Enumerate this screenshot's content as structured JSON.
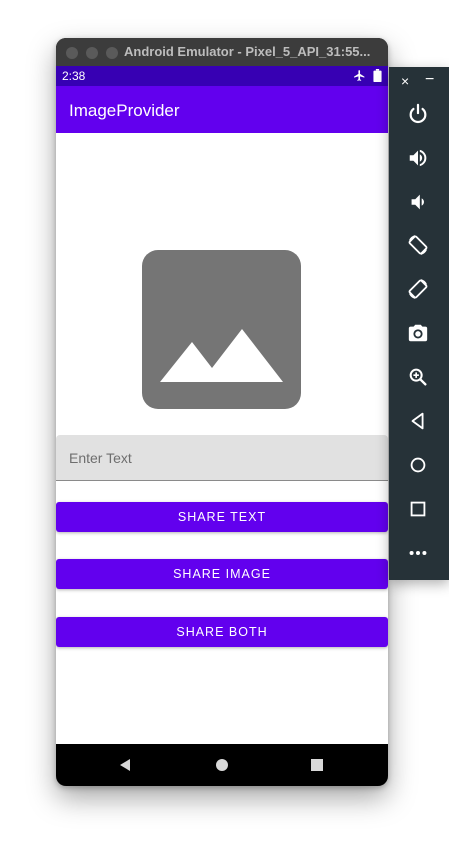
{
  "window": {
    "title": "Android Emulator - Pixel_5_API_31:55..."
  },
  "status_bar": {
    "time": "2:38",
    "icons": [
      "airplane-icon",
      "battery-icon"
    ]
  },
  "app_bar": {
    "title": "ImageProvider",
    "color": "#6200ee"
  },
  "content": {
    "image_placeholder_icon": "image-icon",
    "text_input": {
      "placeholder": "Enter Text",
      "value": ""
    },
    "buttons": [
      {
        "label": "SHARE TEXT"
      },
      {
        "label": "SHARE IMAGE"
      },
      {
        "label": "SHARE BOTH"
      }
    ]
  },
  "nav_bar": {
    "buttons": [
      "back-icon",
      "home-icon",
      "recents-icon"
    ]
  },
  "side_toolbar": {
    "top_controls": {
      "close": "×",
      "minimize": "−"
    },
    "buttons": [
      "power-icon",
      "volume-up-icon",
      "volume-down-icon",
      "rotate-left-icon",
      "rotate-right-icon",
      "camera-icon",
      "zoom-icon",
      "back-icon",
      "home-icon",
      "overview-icon",
      "more-icon"
    ]
  },
  "colors": {
    "primary": "#6200ee",
    "primary_dark": "#3700b3",
    "toolbar": "#263238"
  }
}
